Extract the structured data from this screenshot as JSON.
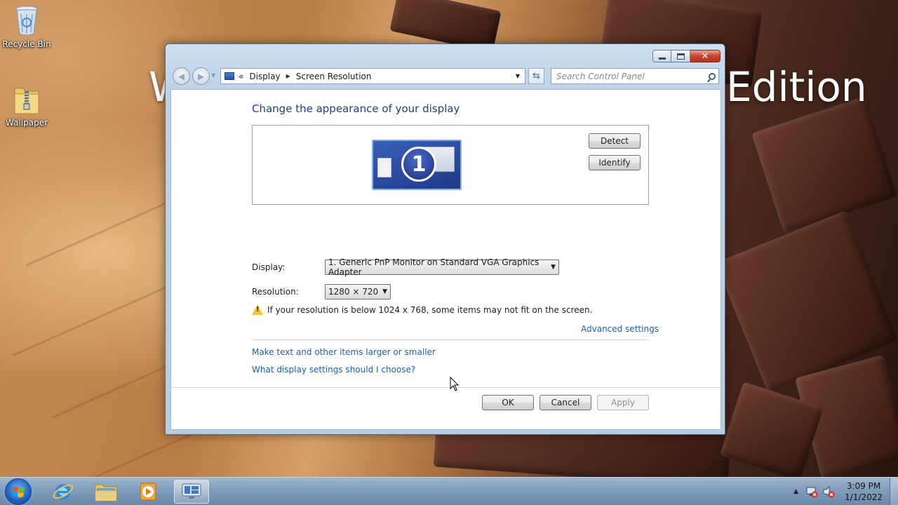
{
  "desktop": {
    "wallpaper_text": "Edition",
    "wallpaper_text_partial": "W",
    "icons": [
      {
        "label": "Recycle Bin",
        "icon": "recycle-bin-icon"
      },
      {
        "label": "Wallpaper",
        "icon": "zip-folder-icon"
      }
    ]
  },
  "window": {
    "address": {
      "root_chevron": "«",
      "crumbs": [
        "Display",
        "Screen Resolution"
      ]
    },
    "search": {
      "placeholder": "Search Control Panel"
    },
    "heading": "Change the appearance of your display",
    "preview": {
      "monitor_number": "1"
    },
    "buttons": {
      "detect": "Detect",
      "identify": "Identify",
      "ok": "OK",
      "cancel": "Cancel",
      "apply": "Apply"
    },
    "display_field": {
      "label": "Display:",
      "value": "1. Generic PnP Monitor on Standard VGA Graphics Adapter"
    },
    "resolution_field": {
      "label": "Resolution:",
      "value": "1280 × 720"
    },
    "warning": "If your resolution is below 1024 x 768, some items may not fit on the screen.",
    "links": {
      "advanced": "Advanced settings",
      "larger_text": "Make text and other items larger or smaller",
      "which_settings": "What display settings should I choose?"
    }
  },
  "taskbar": {
    "pinned": [
      "start-orb",
      "internet-explorer-icon",
      "file-explorer-icon",
      "media-player-icon",
      "control-panel-display-icon"
    ],
    "clock": {
      "time": "3:09 PM",
      "date": "1/1/2022"
    }
  }
}
